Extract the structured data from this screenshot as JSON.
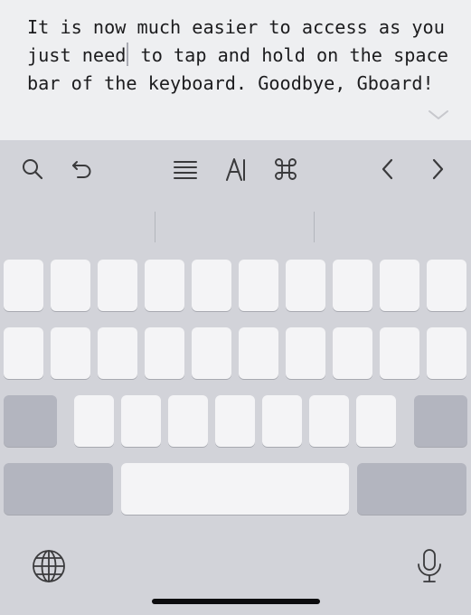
{
  "editor": {
    "text_before_caret": "It is now much easier to access as you just need",
    "text_after_caret": " to tap and hold on the space bar of the keyboard. Goodbye, Gboard!"
  },
  "toolbar": {
    "left_tools": [
      "search-icon",
      "undo-icon"
    ],
    "center_tools": [
      "text-align-icon",
      "text-style-icon",
      "command-icon"
    ],
    "right_tools": [
      "chevron-left-icon",
      "chevron-right-icon"
    ]
  },
  "bottom_bar": {
    "left": "globe-icon",
    "right": "microphone-icon"
  },
  "colors": {
    "editor_background": "#eeeff1",
    "keyboard_background": "#d2d3d9",
    "key_light": "#f4f4f6",
    "key_dark": "#b3b5bf",
    "icon": "#3a3a3c"
  }
}
